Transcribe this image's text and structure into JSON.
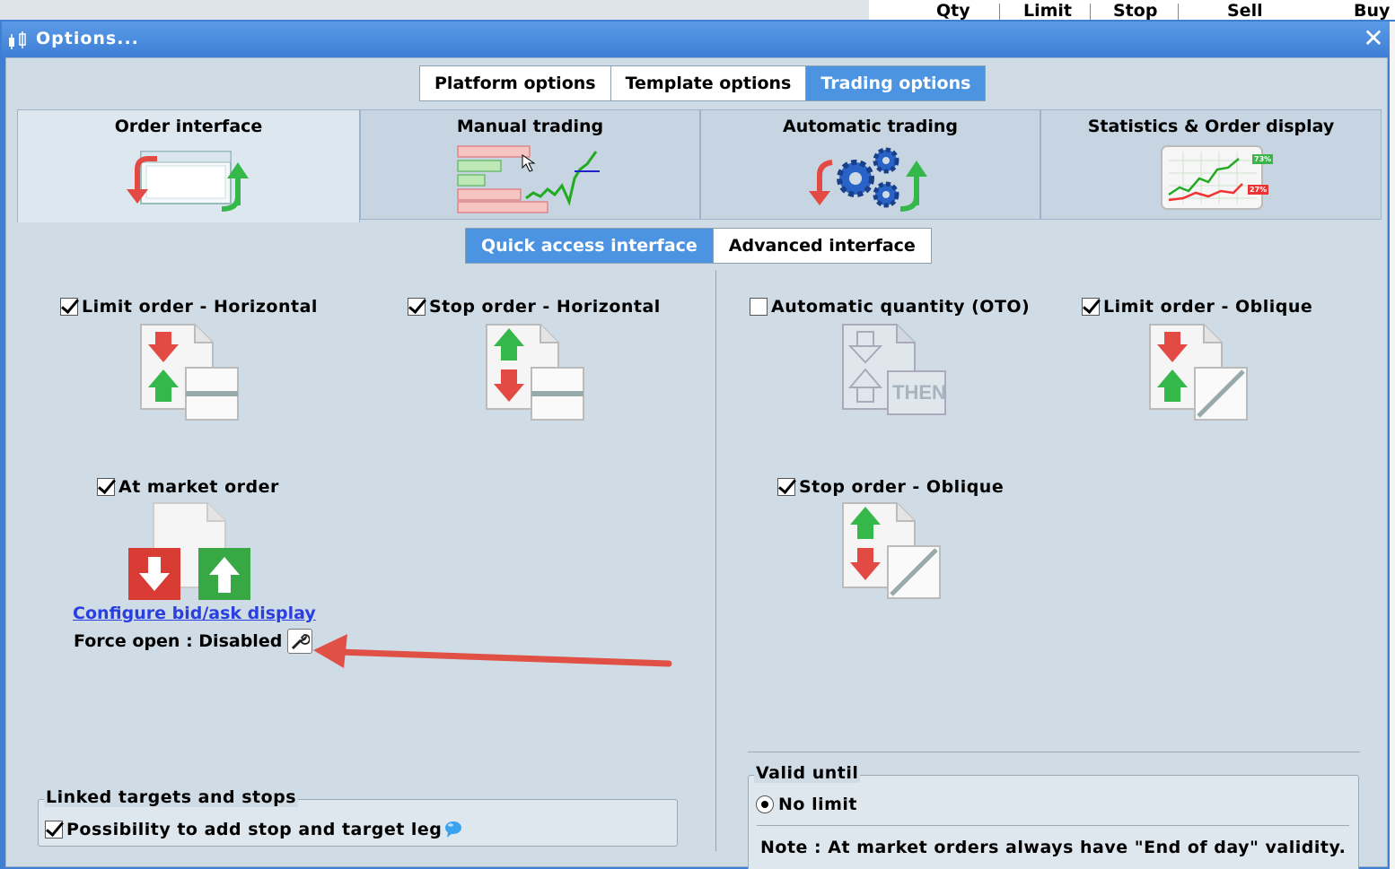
{
  "background": {
    "columns": [
      "Qty",
      "Limit",
      "Stop",
      "Sell",
      "Buy"
    ]
  },
  "dialog": {
    "title": "Options...",
    "close_glyph": "✕",
    "top_tabs": [
      "Platform options",
      "Template options",
      "Trading options"
    ],
    "active_top_tab": "Trading options",
    "categories": [
      "Order interface",
      "Manual trading",
      "Automatic trading",
      "Statistics & Order display"
    ],
    "active_category": "Order interface",
    "stats_badges": [
      "73%",
      "27%"
    ],
    "sub_tabs": [
      "Quick access interface",
      "Advanced interface"
    ],
    "active_sub_tab": "Quick access interface",
    "options": {
      "limit_horizontal": {
        "label": "Limit order - Horizontal",
        "checked": true
      },
      "stop_horizontal": {
        "label": "Stop order - Horizontal",
        "checked": true
      },
      "auto_quantity": {
        "label": "Automatic quantity (OTO)",
        "checked": false,
        "icon_text": "THEN"
      },
      "limit_oblique": {
        "label": "Limit order - Oblique",
        "checked": true
      },
      "at_market": {
        "label": "At market order",
        "checked": true
      },
      "stop_oblique": {
        "label": "Stop order - Oblique",
        "checked": true
      }
    },
    "configure_link": "Configure bid/ask display",
    "force_open": "Force open : Disabled",
    "linked_group": {
      "title": "Linked targets and stops",
      "option": "Possibility to add stop and target leg",
      "checked": true
    },
    "valid_group": {
      "title": "Valid until",
      "radio_label": "No limit",
      "note": "Note : At market orders always have \"End of day\" validity."
    }
  },
  "colors": {
    "accent": "#4c93e2",
    "title_bar": "#3d7fd6",
    "panel": "#cfdce6",
    "link": "#2a3fe0",
    "arrow_red": "#e24a43",
    "arrow_green": "#35b84a"
  }
}
